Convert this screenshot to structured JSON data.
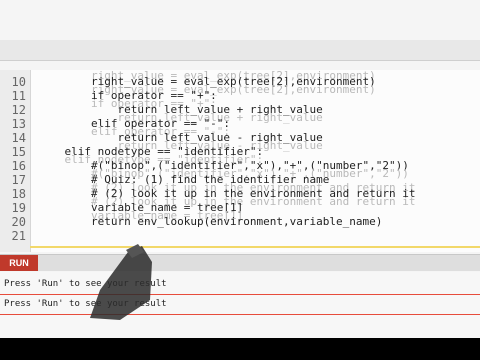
{
  "code_lines": [
    {
      "num": "10",
      "text": "        right_value = eval_exp(tree[2],environment)",
      "ghost": "        right_value = eval_exp(tree[2],environment)"
    },
    {
      "num": "11",
      "text": "        if operator == \"+\":",
      "ghost": "        right_value = eval_exp(tree[2],environment)"
    },
    {
      "num": "12",
      "text": "            return left_value + right_value",
      "ghost": "        if operator == \"+\":"
    },
    {
      "num": "13",
      "text": "        elif operator == \"-\":",
      "ghost": "            return left_value + right_value"
    },
    {
      "num": "14",
      "text": "            return left_value - right_value",
      "ghost": "        elif operator == \"-\":"
    },
    {
      "num": "15",
      "text": "    elif nodetype == \"identifier\":",
      "ghost": "            return left_value - right_value"
    },
    {
      "num": "16",
      "text": "        #(\"binop\",(\"identifier\",\"x\"),\"+\",(\"number\",\"2\"))",
      "ghost": "    elif nodetype == \"identifier\":"
    },
    {
      "num": "17",
      "text": "        # Quiz: (1) find the identifier name",
      "ghost": "        #(\"binop\",(\"identifier\",\"x\"),\"+\",(\"number\",\"2\"))"
    },
    {
      "num": "18",
      "text": "        # (2) look it up in the environment and return it",
      "ghost": "        # (2) look it up in the environment and return it"
    },
    {
      "num": "19",
      "text": "        variable_name = tree[1]",
      "ghost": "        # (2) look it up in the environment and return it"
    },
    {
      "num": "20",
      "text": "        return env_lookup(environment,variable_name)",
      "ghost": "        variable_name = tree[1]"
    },
    {
      "num": "21",
      "text": "",
      "ghost": ""
    }
  ],
  "run_button": {
    "label": "RUN"
  },
  "output": {
    "line1": "Press 'Run' to see your result",
    "line2": "Press 'Run' to see your result"
  },
  "colors": {
    "run": "#c0392b",
    "divider": "#e74c3c"
  }
}
